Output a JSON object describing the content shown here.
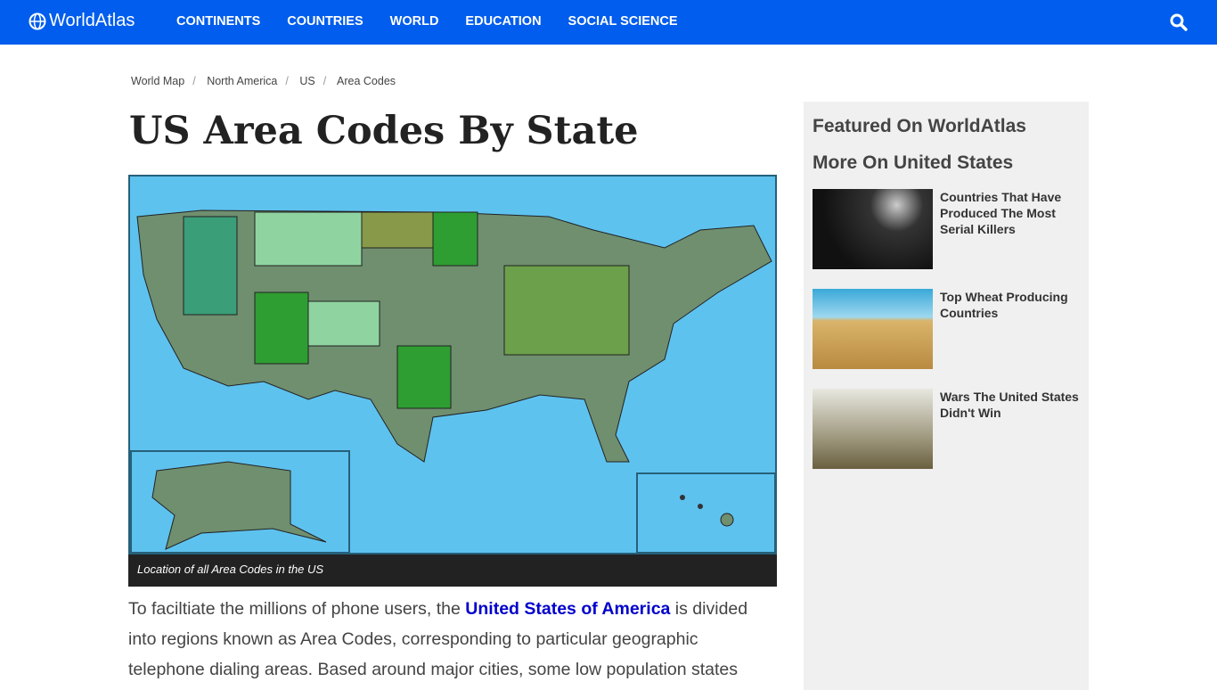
{
  "nav": {
    "logo": "WorldAtlas",
    "items": [
      "CONTINENTS",
      "COUNTRIES",
      "WORLD",
      "EDUCATION",
      "SOCIAL SCIENCE"
    ],
    "color": "#005ded"
  },
  "breadcrumb": [
    "World Map",
    "North America",
    "US",
    "Area Codes"
  ],
  "title": "US Area Codes By State",
  "map": {
    "caption": "Location of all Area Codes in the US"
  },
  "article": {
    "before": "To faciltiate the millions of phone users, the ",
    "link": "United States of America",
    "after": " is divided into regions known as Area Codes, corresponding to particular geographic telephone dialing areas. Based around major cities, some low population states"
  },
  "sidebar": {
    "featured": "Featured On WorldAtlas",
    "more": "More On United States",
    "items": [
      {
        "title": "Countries That Have Produced The Most Serial Killers"
      },
      {
        "title": "Top Wheat Producing Countries"
      },
      {
        "title": "Wars The United States Didn't Win"
      }
    ]
  }
}
